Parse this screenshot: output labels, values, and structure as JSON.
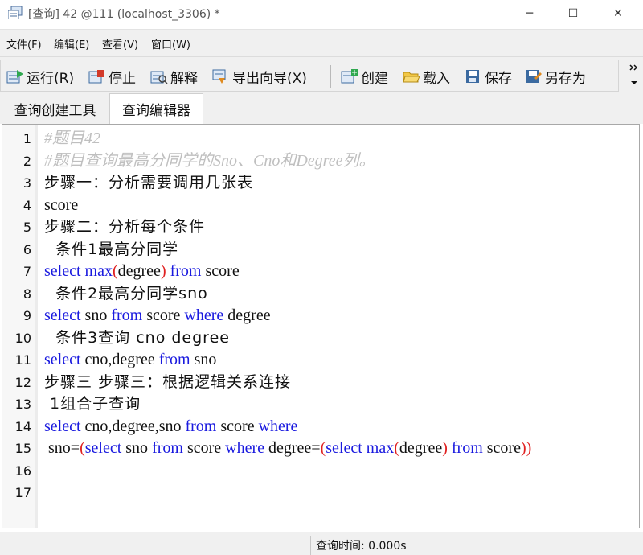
{
  "window": {
    "title": "[查询] 42 @111 (localhost_3306) *",
    "controls": {
      "minimize": "─",
      "maximize": "☐",
      "close": "✕"
    }
  },
  "menu": [
    "文件(F)",
    "编辑(E)",
    "查看(V)",
    "窗口(W)"
  ],
  "toolbar": {
    "run": "运行(R)",
    "stop": "停止",
    "explain": "解释",
    "export": "导出向导(X)",
    "create": "创建",
    "load": "载入",
    "save": "保存",
    "save_as": "另存为"
  },
  "tabs": [
    {
      "label": "查询创建工具",
      "active": false
    },
    {
      "label": "查询编辑器",
      "active": true
    }
  ],
  "editor": {
    "line_numbers": [
      "1",
      "2",
      "3",
      "4",
      "5",
      "6",
      "7",
      "8",
      "9",
      "10",
      "11",
      "12",
      "13",
      "14",
      "15",
      "16",
      "17"
    ],
    "lines": [
      [
        {
          "t": "#题目42",
          "c": "comment"
        }
      ],
      [
        {
          "t": "#题目查询最高分同学的Sno、Cno和Degree列。",
          "c": "comment"
        }
      ],
      [
        {
          "t": "步骤一：分析需要调用几张表",
          "c": "cn"
        }
      ],
      [
        {
          "t": "score",
          "c": ""
        }
      ],
      [
        {
          "t": "步骤二：分析每个条件",
          "c": "cn"
        }
      ],
      [
        {
          "t": "  条件1最高分同学",
          "c": "cn"
        }
      ],
      [
        {
          "t": "select",
          "c": "kw"
        },
        {
          "t": " ",
          "c": ""
        },
        {
          "t": "max",
          "c": "kw"
        },
        {
          "t": "(",
          "c": "paren"
        },
        {
          "t": "degree",
          "c": ""
        },
        {
          "t": ")",
          "c": "paren"
        },
        {
          "t": " ",
          "c": ""
        },
        {
          "t": "from",
          "c": "kw"
        },
        {
          "t": " score",
          "c": ""
        }
      ],
      [
        {
          "t": "  条件2最高分同学sno",
          "c": "cn"
        }
      ],
      [
        {
          "t": "select",
          "c": "kw"
        },
        {
          "t": " sno ",
          "c": ""
        },
        {
          "t": "from",
          "c": "kw"
        },
        {
          "t": " score ",
          "c": ""
        },
        {
          "t": "where",
          "c": "kw"
        },
        {
          "t": " degree",
          "c": ""
        }
      ],
      [
        {
          "t": "  条件3查询 cno degree",
          "c": "cn"
        }
      ],
      [
        {
          "t": "select",
          "c": "kw"
        },
        {
          "t": " cno,degree ",
          "c": ""
        },
        {
          "t": "from",
          "c": "kw"
        },
        {
          "t": " sno",
          "c": ""
        }
      ],
      [
        {
          "t": "步骤三 步骤三：根据逻辑关系连接",
          "c": "cn"
        }
      ],
      [
        {
          "t": " 1组合子查询",
          "c": "cn"
        }
      ],
      [
        {
          "t": "select",
          "c": "kw"
        },
        {
          "t": " cno,degree,sno ",
          "c": ""
        },
        {
          "t": "from",
          "c": "kw"
        },
        {
          "t": " score ",
          "c": ""
        },
        {
          "t": "where",
          "c": "kw"
        }
      ],
      [
        {
          "t": " sno=",
          "c": ""
        },
        {
          "t": "(",
          "c": "paren"
        },
        {
          "t": "select",
          "c": "kw"
        },
        {
          "t": " sno ",
          "c": ""
        },
        {
          "t": "from",
          "c": "kw"
        },
        {
          "t": " score ",
          "c": ""
        },
        {
          "t": "where",
          "c": "kw"
        },
        {
          "t": " degree=",
          "c": ""
        },
        {
          "t": "(",
          "c": "paren"
        },
        {
          "t": "select",
          "c": "kw"
        },
        {
          "t": " ",
          "c": ""
        },
        {
          "t": "max",
          "c": "kw"
        },
        {
          "t": "(",
          "c": "paren"
        },
        {
          "t": "degree",
          "c": ""
        },
        {
          "t": ")",
          "c": "paren"
        },
        {
          "t": " ",
          "c": ""
        },
        {
          "t": "from",
          "c": "kw"
        },
        {
          "t": " score",
          "c": ""
        },
        {
          "t": "))",
          "c": "paren"
        }
      ],
      [],
      []
    ]
  },
  "status": {
    "query_time": "查询时间: 0.000s"
  },
  "colors": {
    "keyword": "#1a1adf",
    "paren": "#e02020",
    "comment": "#bfbfbf"
  }
}
